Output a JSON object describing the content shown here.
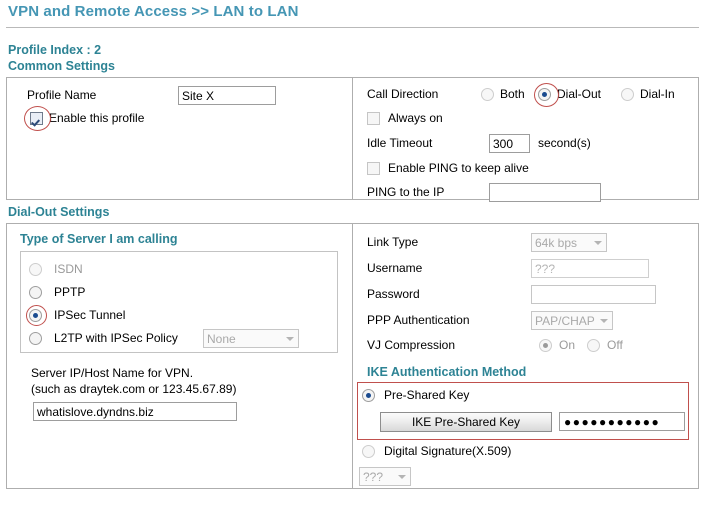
{
  "header": {
    "title": "VPN and Remote Access >> LAN to LAN"
  },
  "profile": {
    "index_label": "Profile Index : 2",
    "common_settings_heading": "Common Settings"
  },
  "common_settings": {
    "left": {
      "profile_name_label": "Profile Name",
      "profile_name_value": "Site X",
      "enable_profile_label": "Enable this profile",
      "enable_profile_checked": true
    },
    "right": {
      "call_direction_label": "Call Direction",
      "call_direction_options": [
        "Both",
        "Dial-Out",
        "Dial-In"
      ],
      "call_direction_selected": "Dial-Out",
      "always_on_label": "Always on",
      "always_on_checked": false,
      "idle_timeout_label": "Idle Timeout",
      "idle_timeout_value": "300",
      "idle_timeout_unit": "second(s)",
      "enable_ping_label": "Enable PING to keep alive",
      "enable_ping_checked": false,
      "ping_ip_label": "PING to the IP",
      "ping_ip_value": ""
    }
  },
  "dial_out_settings": {
    "heading": "Dial-Out Settings",
    "left": {
      "type_of_server_heading": "Type of Server I am calling",
      "server_types": [
        {
          "label": "ISDN",
          "selected": false,
          "disabled": true
        },
        {
          "label": "PPTP",
          "selected": false,
          "disabled": false
        },
        {
          "label": "IPSec Tunnel",
          "selected": true,
          "disabled": false
        },
        {
          "label": "L2TP with IPSec Policy",
          "selected": false,
          "disabled": false
        }
      ],
      "l2tp_policy_value": "None",
      "server_ip_label_line1": "Server IP/Host Name for VPN.",
      "server_ip_label_line2": "(such as draytek.com or 123.45.67.89)",
      "server_ip_value": "whatislove.dyndns.biz"
    },
    "right": {
      "link_type_label": "Link Type",
      "link_type_value": "64k bps",
      "username_label": "Username",
      "username_placeholder": "???",
      "username_value": "",
      "password_label": "Password",
      "password_value": "",
      "ppp_auth_label": "PPP Authentication",
      "ppp_auth_value": "PAP/CHAP",
      "vj_compression_label": "VJ Compression",
      "vj_options": [
        "On",
        "Off"
      ],
      "vj_selected": "On",
      "ike_heading": "IKE Authentication Method",
      "pre_shared_key_label": "Pre-Shared Key",
      "pre_shared_key_selected": true,
      "ike_psk_button_label": "IKE Pre-Shared Key",
      "ike_psk_masked_value": "●●●●●●●●●●●",
      "digital_signature_label": "Digital Signature(X.509)",
      "digital_signature_selected": false,
      "digital_signature_cert_value": "???"
    }
  },
  "colors": {
    "title": "#4596b4",
    "section_heading": "#2d8394",
    "annotation": "#c0504d",
    "panel_border": "#aeaeae"
  }
}
